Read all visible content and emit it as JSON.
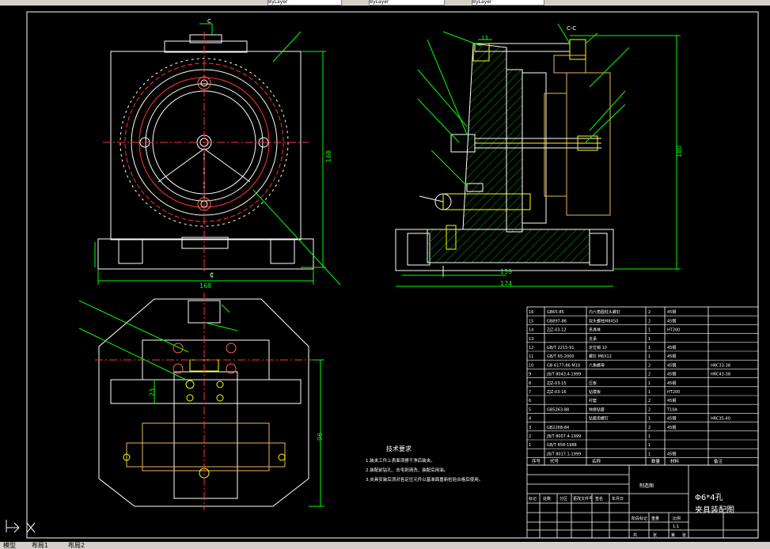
{
  "toolbar": {
    "layer_combo": "ByLayer",
    "linetype_combo": "ByLayer",
    "lineweight_combo": "ByLayer"
  },
  "tabs": {
    "model": "模型",
    "layout1": "布局1",
    "layout2": "布局2"
  },
  "drawing": {
    "section_marker": "C",
    "section_label": "C-C",
    "dims": {
      "front_width": "168",
      "front_height": "168",
      "side_139": "139",
      "side_174": "174",
      "side_height": "180",
      "side_13": "13",
      "top_23": "23",
      "top_96": "96"
    },
    "notes_title": "技术要求",
    "notes": [
      "1.装夹工件上表面须擦干净后装夹。",
      "2.装配前钻孔、去毛刺清洗，装配后用油。",
      "3.夹具安装后须对各定位元件以基准面重新检验合格后使用。"
    ],
    "bom": [
      [
        "16",
        "GB65-85",
        "内六角圆柱头螺钉",
        "2",
        "45钢",
        ""
      ],
      [
        "15",
        "GB897-86",
        "双头螺柱M8X50",
        "2",
        "45钢",
        ""
      ],
      [
        "14",
        "ZJZ-03-12",
        "夹具体",
        "1",
        "HT200",
        ""
      ],
      [
        "13",
        "",
        "支承",
        "1",
        "",
        ""
      ],
      [
        "12",
        "GB/T 2215-91",
        "定位销 10",
        "1",
        "45钢",
        ""
      ],
      [
        "11",
        "GB/T 65-2000",
        "螺钉 M6X12",
        "1",
        "45钢",
        ""
      ],
      [
        "10",
        "GB 6177-86 M10",
        "六角螺母",
        "2",
        "45钢",
        "HRC33-38"
      ],
      [
        "9",
        "JB/T 8043.4-1999",
        "",
        "2",
        "45钢",
        "HRC43-38"
      ],
      [
        "8",
        "ZJZ-03-15",
        "压板",
        "1",
        "45钢",
        ""
      ],
      [
        "7",
        "ZJZ-03-16",
        "钻模板",
        "1",
        "HT200",
        ""
      ],
      [
        "6",
        "",
        "衬套",
        "2",
        "45钢",
        ""
      ],
      [
        "5",
        "GB5263-88",
        "快换钻套",
        "2",
        "T10A",
        ""
      ],
      [
        "4",
        "",
        "钻套用螺钉",
        "1",
        "45钢",
        "HRC35-40"
      ],
      [
        "3",
        "GB2268-84",
        "",
        "2",
        "45钢",
        ""
      ],
      [
        "2",
        "JB/T 8007.4-1999",
        "",
        "1",
        "",
        ""
      ],
      [
        "1",
        "GB/T 858-1988",
        "",
        "1",
        "",
        ""
      ],
      [
        "",
        "JB/T 8017.1-1999",
        "",
        "1",
        "45钢",
        ""
      ]
    ],
    "bom_header": [
      "序号",
      "代号",
      "名称",
      "数量",
      "材料",
      "备注"
    ],
    "title_block": {
      "part_name_1": "Φ6*4孔",
      "part_name_2": "夹具装配图",
      "label_zhizao": "制造图",
      "row_labels": [
        "标记",
        "处数",
        "分区",
        "更改文件号",
        "签名",
        "年月日"
      ],
      "stage_label": "阶段标记",
      "weight_label": "重量",
      "scale_label": "比例",
      "scale_value": "1:1",
      "sheet_labels": [
        "共",
        "张",
        "第",
        "张"
      ]
    }
  },
  "colors": {
    "background": "#000000",
    "line": "#ffffff",
    "dim": "#00ff00",
    "hatch": "#00aa00",
    "center": "#ff3333",
    "yellow": "#ffff00",
    "orange": "#e8b860"
  }
}
